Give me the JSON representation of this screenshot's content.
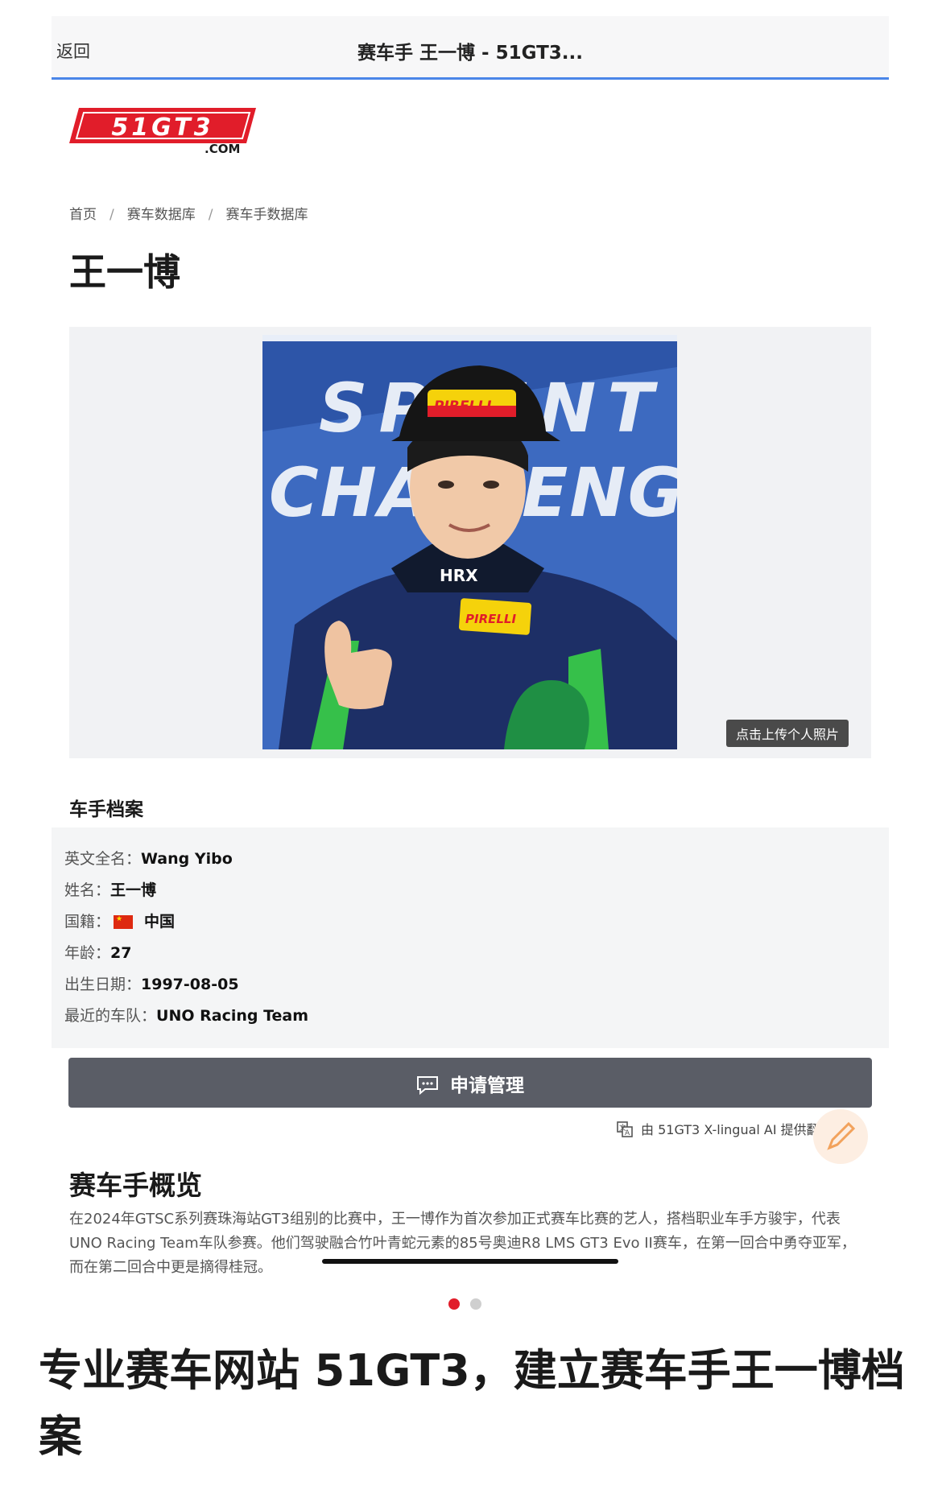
{
  "nav": {
    "back_label": "返回",
    "page_title": "赛车手 王一博 - 51GT3..."
  },
  "logo": {
    "text": "51GT3",
    "suffix": ".COM",
    "color": "#e11d2a"
  },
  "breadcrumb": [
    "首页",
    "赛车数据库",
    "赛车手数据库"
  ],
  "driver": {
    "name": "王一博"
  },
  "photo": {
    "upload_label": "点击上传个人照片",
    "banner_line1": "SPRINT",
    "banner_line2": "CHALLENGE",
    "cap_brand": "PIRELLI",
    "suit_brand": "HRX"
  },
  "profile": {
    "heading": "车手档案",
    "rows": [
      {
        "label": "英文全名：",
        "value": "Wang Yibo"
      },
      {
        "label": "姓名：",
        "value": "王一博"
      },
      {
        "label": "国籍：",
        "value": "中国"
      },
      {
        "label": "年龄：",
        "value": "27"
      },
      {
        "label": "出生日期：",
        "value": "1997-08-05"
      },
      {
        "label": "最近的车队：",
        "value": "UNO Racing Team"
      }
    ]
  },
  "manage_button": {
    "label": "申请管理"
  },
  "ai_note": "由 51GT3 X-lingual AI 提供翻译",
  "overview": {
    "heading": "赛车手概览",
    "text": "在2024年GTSC系列赛珠海站GT3组别的比赛中，王一博作为首次参加正式赛车比赛的艺人，搭档职业车手方骏宇，代表UNO Racing Team车队参赛。他们驾驶融合竹叶青蛇元素的85号奥迪R8 LMS GT3 Evo II赛车，在第一回合中勇夺亚军，而在第二回合中更是摘得桂冠。"
  },
  "carousel": {
    "active_index": 0,
    "count": 2
  },
  "caption": "专业赛车网站 51GT3，建立赛车手王一博档案",
  "colors": {
    "accent_red": "#e11d2a",
    "nav_underline": "#4a86e8",
    "button_bg": "#5a5d66"
  },
  "icons": [
    "chat-icon",
    "translate-icon",
    "edit-pencil-icon"
  ]
}
